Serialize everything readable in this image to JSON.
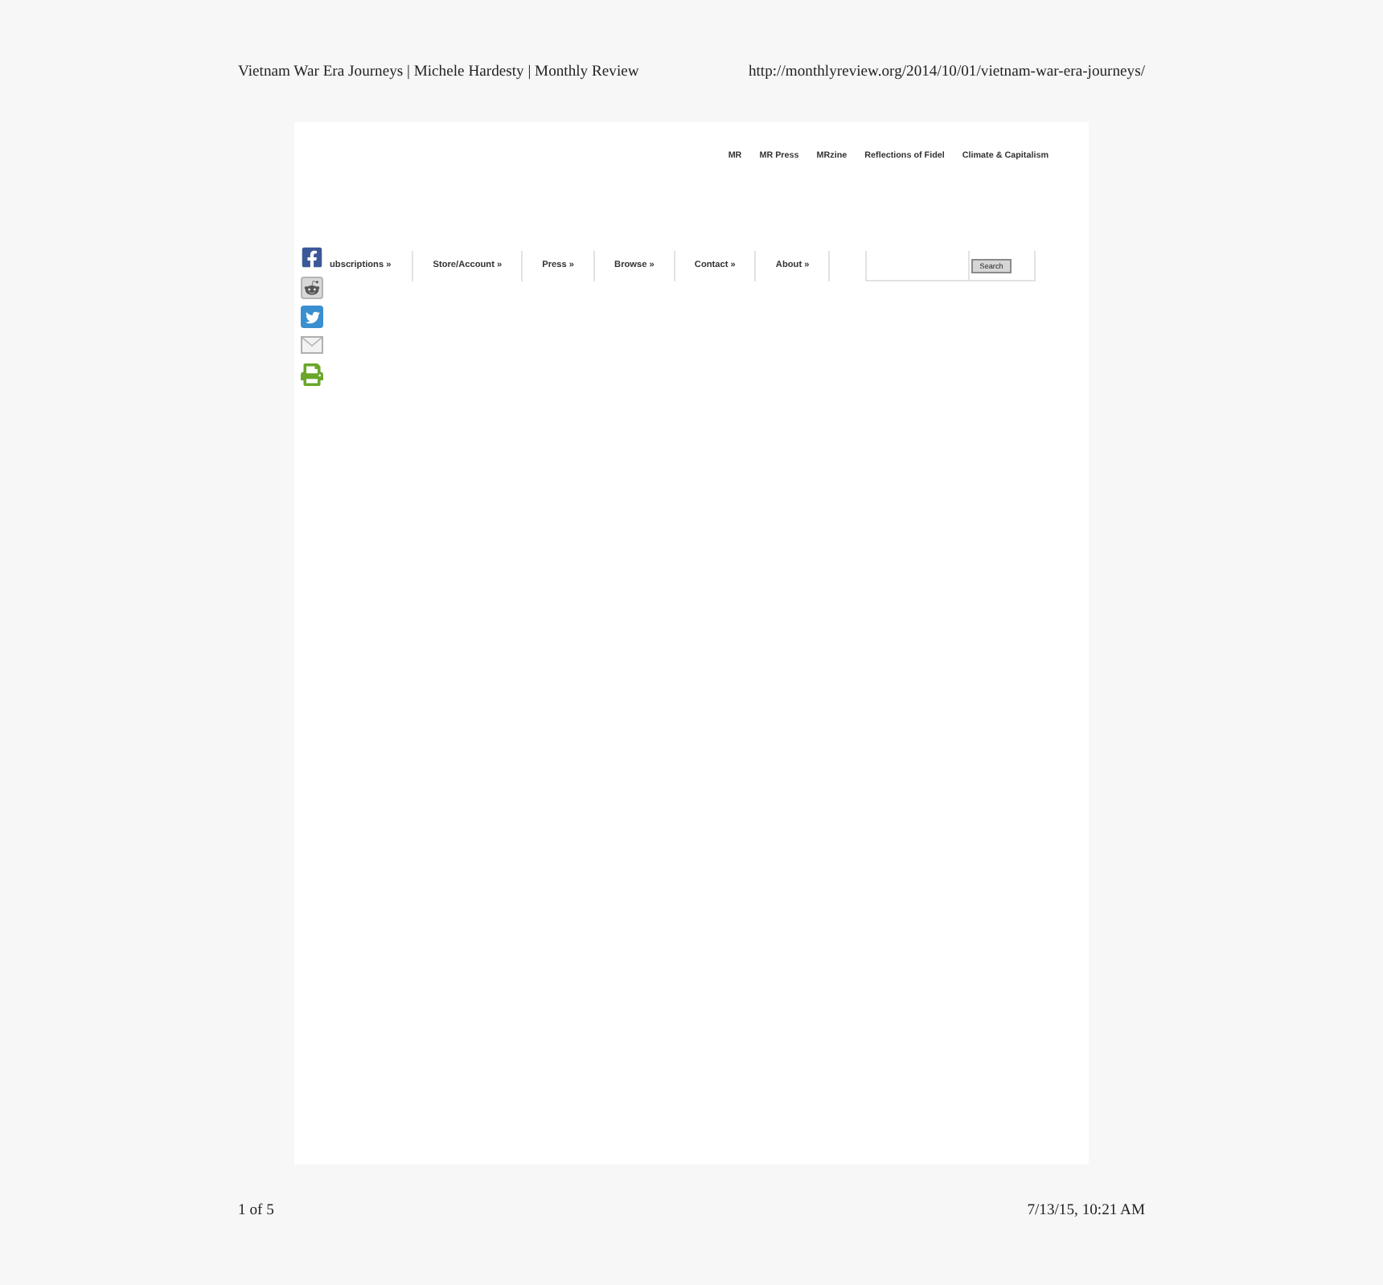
{
  "header": {
    "title": "Vietnam War Era Journeys | Michele Hardesty | Monthly Review",
    "url": "http://monthlyreview.org/2014/10/01/vietnam-war-era-journeys/"
  },
  "top_links": [
    "MR",
    "MR Press",
    "MRzine",
    "Reflections of Fidel",
    "Climate & Capitalism"
  ],
  "nav": [
    "ubscriptions »",
    "Store/Account »",
    "Press »",
    "Browse »",
    "Contact »",
    "About »"
  ],
  "search": {
    "button": "Search"
  },
  "footer": {
    "page": "1 of 5",
    "date": "7/13/15, 10:21 AM"
  }
}
